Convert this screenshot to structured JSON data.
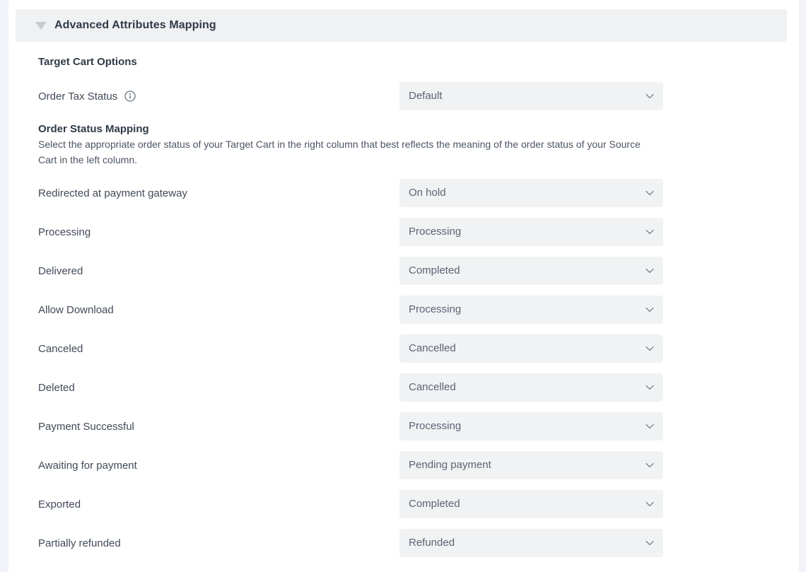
{
  "panel": {
    "title": "Advanced Attributes Mapping",
    "collapse_icon": "triangle-down-icon",
    "expanded": true
  },
  "target_cart_options": {
    "section_title": "Target Cart Options",
    "order_tax_status": {
      "label": "Order Tax Status",
      "info_icon": "info-circle-icon",
      "value": "Default",
      "options": [
        "Default"
      ]
    }
  },
  "order_status_mapping": {
    "section_title": "Order Status Mapping",
    "description": "Select the appropriate order status of your Target Cart in the right column that best reflects the meaning of the order status of your Source Cart in the left column.",
    "chevron_icon": "chevron-down-icon",
    "target_status_options": [
      "On hold",
      "Processing",
      "Completed",
      "Cancelled",
      "Pending payment",
      "Refunded"
    ],
    "rows": [
      {
        "source_status": "Redirected at payment gateway",
        "target_status": "On hold"
      },
      {
        "source_status": "Processing",
        "target_status": "Processing"
      },
      {
        "source_status": "Delivered",
        "target_status": "Completed"
      },
      {
        "source_status": "Allow Download",
        "target_status": "Processing"
      },
      {
        "source_status": "Canceled",
        "target_status": "Cancelled"
      },
      {
        "source_status": "Deleted",
        "target_status": "Cancelled"
      },
      {
        "source_status": "Payment Successful",
        "target_status": "Processing"
      },
      {
        "source_status": "Awaiting for payment",
        "target_status": "Pending payment"
      },
      {
        "source_status": "Exported",
        "target_status": "Completed"
      },
      {
        "source_status": "Partially refunded",
        "target_status": "Refunded"
      }
    ]
  },
  "colors": {
    "page_background": "#f2f3f8",
    "sheet_background": "#ffffff",
    "panel_header_background": "#f0f1f3",
    "select_background": "#f1f2f4",
    "heading_text": "#303a48",
    "body_text": "#414a57",
    "muted_text": "#5b6472"
  }
}
